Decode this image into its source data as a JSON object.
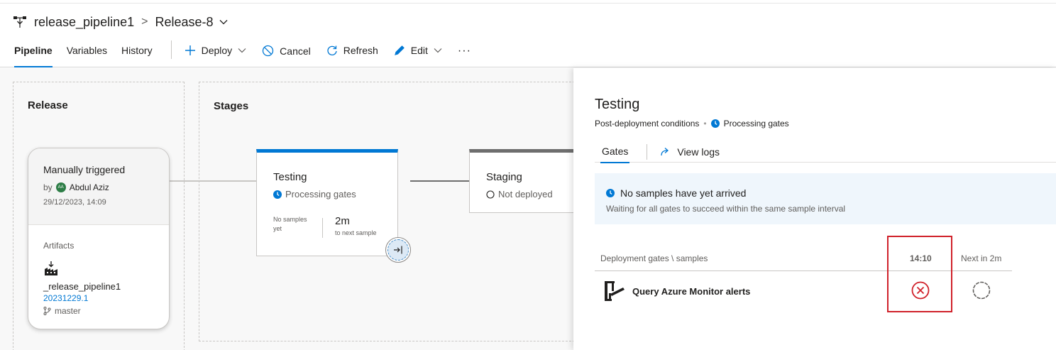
{
  "header": {
    "pipeline_name": "release_pipeline1",
    "separator": ">",
    "release_name": "Release-8"
  },
  "tabs": [
    {
      "label": "Pipeline"
    },
    {
      "label": "Variables"
    },
    {
      "label": "History"
    }
  ],
  "toolbar": {
    "deploy_label": "Deploy",
    "cancel_label": "Cancel",
    "refresh_label": "Refresh",
    "edit_label": "Edit",
    "more_label": "···"
  },
  "canvas": {
    "release_title": "Release",
    "stages_title": "Stages",
    "trigger": {
      "title": "Manually triggered",
      "by_label": "by",
      "avatar_initials": "AA",
      "author": "Abdul Aziz",
      "date": "29/12/2023, 14:09",
      "artifacts_label": "Artifacts",
      "artifact_name": "_release_pipeline1",
      "artifact_version": "20231229.1",
      "branch": "master"
    },
    "stages": [
      {
        "name": "Testing",
        "status": "Processing gates",
        "samples_text": "No samples yet",
        "next_value": "2m",
        "next_label": "to next sample"
      },
      {
        "name": "Staging",
        "status": "Not deployed"
      }
    ]
  },
  "panel": {
    "title": "Testing",
    "subtitle_condition": "Post-deployment conditions",
    "subtitle_dot": "•",
    "subtitle_status": "Processing gates",
    "tabs": {
      "gates": "Gates",
      "view_logs": "View logs"
    },
    "info": {
      "title": "No samples have yet arrived",
      "description": "Waiting for all gates to succeed within the same sample interval"
    },
    "gates_table": {
      "header_label": "Deployment gates \\ samples",
      "sample_time": "14:10",
      "next_label": "Next in 2m",
      "rows": [
        {
          "name": "Query Azure Monitor alerts",
          "sample_status": "failed",
          "next_status": "pending"
        }
      ]
    }
  },
  "colors": {
    "accent": "#0078d4",
    "failed": "#d0212a",
    "highlight": "#d0212a"
  },
  "icons": {
    "pipeline": "pipeline-icon",
    "deploy": "plus-icon",
    "cancel": "cancel-icon",
    "refresh": "refresh-icon",
    "edit": "pencil-icon",
    "gate": "gate-icon",
    "failed": "x-circle-icon",
    "pending": "spinner-icon"
  }
}
